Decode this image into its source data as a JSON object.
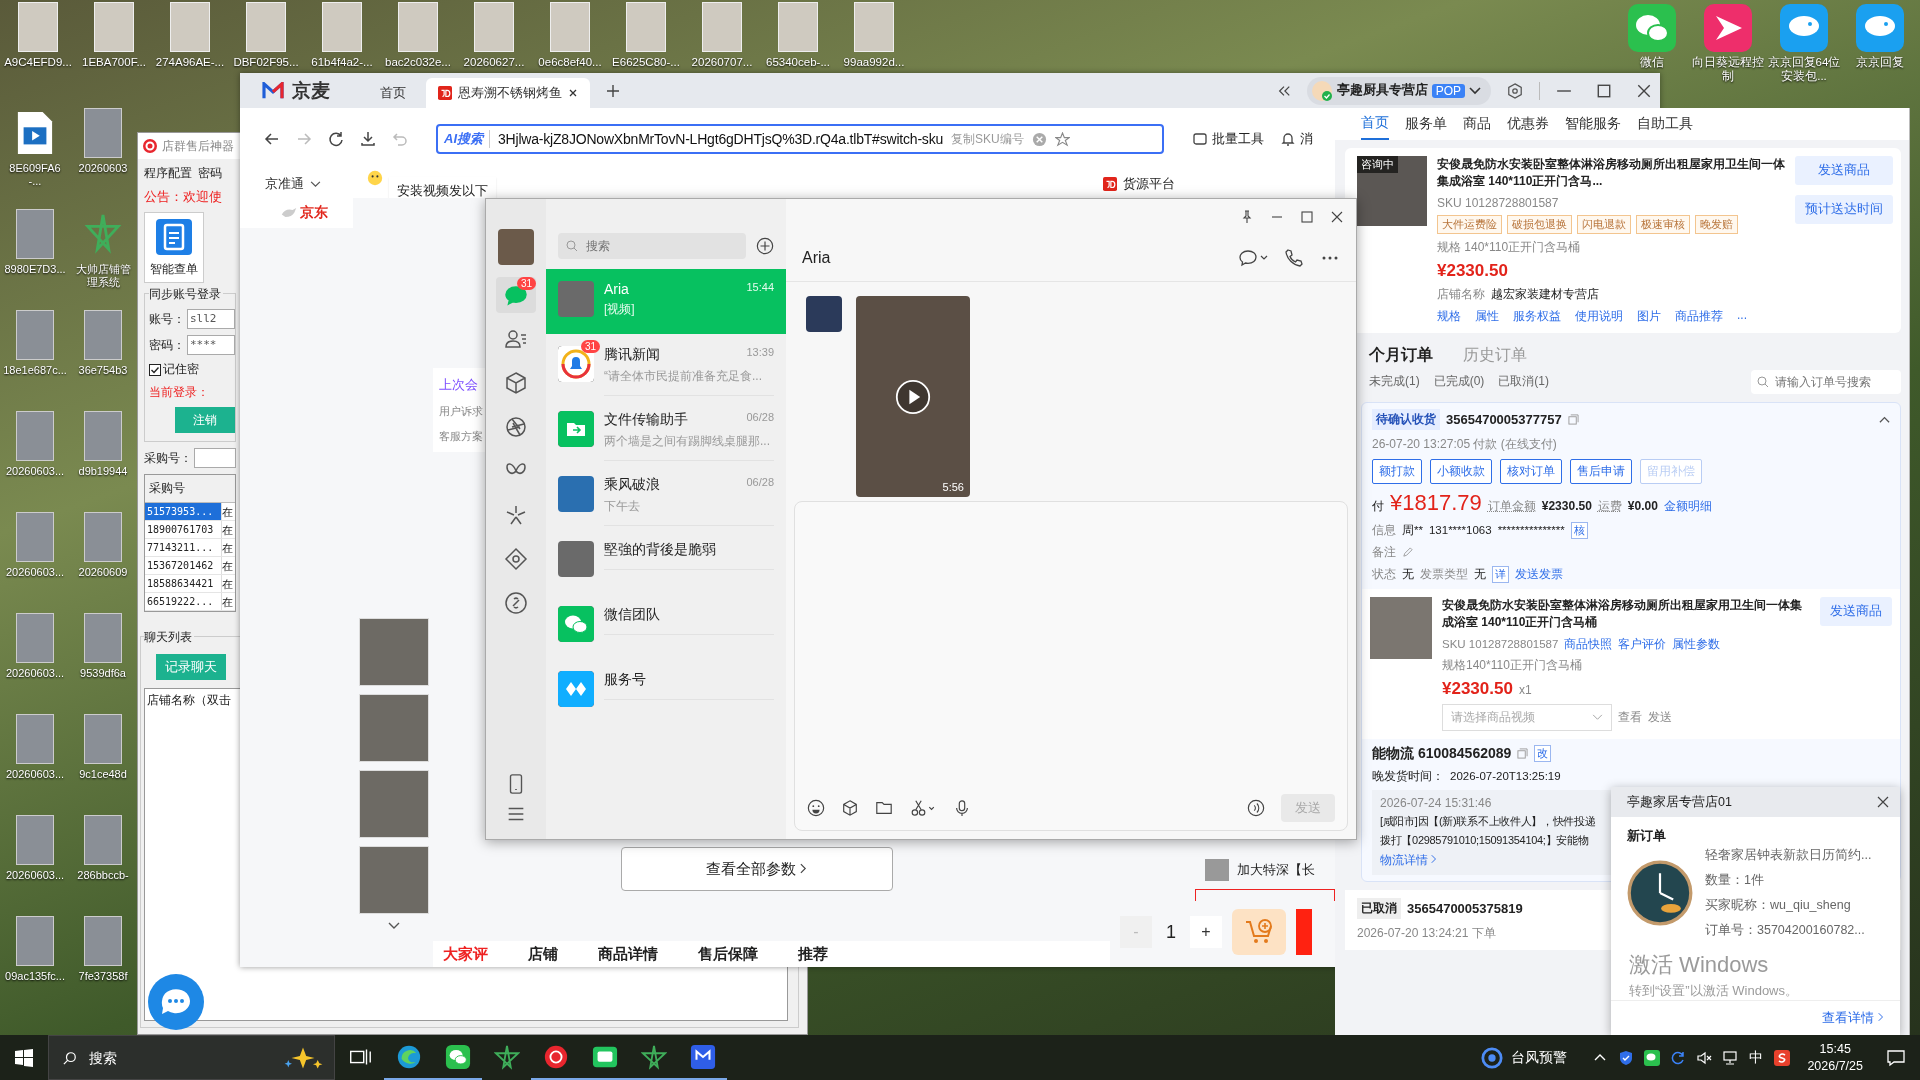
{
  "desktop": {
    "top_icons": [
      {
        "label": "A9C4EFD9..."
      },
      {
        "label": "1EBA700F..."
      },
      {
        "label": "274A96AE-..."
      },
      {
        "label": "DBF02F95..."
      },
      {
        "label": "61b4f4a2-..."
      },
      {
        "label": "bac2c032e..."
      },
      {
        "label": "20260627..."
      },
      {
        "label": "0e6c8ef40..."
      },
      {
        "label": "E6625C80-..."
      },
      {
        "label": "20260707..."
      },
      {
        "label": "65340ceb-..."
      },
      {
        "label": "99aa992d..."
      }
    ],
    "left_icons": [
      {
        "label": "8E609FA6-...",
        "kind": "video"
      },
      {
        "label": "20260603",
        "kind": "thumbnail"
      },
      {
        "label": "8980E7D3...",
        "kind": "thumbnail"
      },
      {
        "label": "大帅店铺管理系统",
        "kind": "star"
      },
      {
        "label": "18e1e687c...",
        "kind": "thumbnail"
      },
      {
        "label": "36e754b3",
        "kind": "thumbnail"
      },
      {
        "label": "20260603...",
        "kind": "thumbnail"
      },
      {
        "label": "d9b19944",
        "kind": "thumbnail"
      },
      {
        "label": "20260603...",
        "kind": "thumbnail"
      },
      {
        "label": "20260609",
        "kind": "thumbnail"
      },
      {
        "label": "20260603...",
        "kind": "thumbnail"
      },
      {
        "label": "9539df6a",
        "kind": "thumbnail"
      },
      {
        "label": "20260603...",
        "kind": "thumbnail"
      },
      {
        "label": "9c1ce48d",
        "kind": "thumbnail"
      },
      {
        "label": "20260603...",
        "kind": "thumbnail"
      },
      {
        "label": "286bbccb-",
        "kind": "thumbnail"
      },
      {
        "label": "09ac135fc...",
        "kind": "thumbnail"
      },
      {
        "label": "7fe37358f",
        "kind": "thumbnail"
      }
    ],
    "app_icons": [
      {
        "label": "微信",
        "kind": "wechat"
      },
      {
        "label": "向日葵远程控制",
        "kind": "sunflower"
      },
      {
        "label": "京京回复64位安装包...",
        "kind": "reply"
      },
      {
        "label": "京京回复",
        "kind": "reply"
      }
    ]
  },
  "helper_window": {
    "title": "店群售后神器",
    "menu": [
      "程序配置",
      "密码"
    ],
    "notice": "公告：欢迎使",
    "tool": "智能查单",
    "login": {
      "legend": "同步账号登录",
      "account_label": "账号：",
      "account": "sll2",
      "password_label": "密码：",
      "password": "****",
      "remember": {
        "label": "记住密",
        "checked": true
      },
      "current": "当前登录：",
      "logout": "注销"
    },
    "purchase_label": "采购号：",
    "table": {
      "column": "采购号",
      "rows": [
        {
          "id": "51573953...",
          "status": "在",
          "selected": true
        },
        {
          "id": "18900761703",
          "status": "在",
          "selected": false
        },
        {
          "id": "77143211...",
          "status": "在",
          "selected": false
        },
        {
          "id": "15367201462",
          "status": "在",
          "selected": false
        },
        {
          "id": "18588634421",
          "status": "在",
          "selected": false
        },
        {
          "id": "66519222...",
          "status": "在",
          "selected": false
        }
      ]
    },
    "chat_list": {
      "legend": "聊天列表",
      "button": "记录聊天",
      "column": "店铺名称（双击"
    }
  },
  "browser": {
    "app_name": "京麦",
    "tabs": [
      {
        "label": "首页",
        "selected": false
      },
      {
        "label": "恩寿溯不锈钢烤鱼",
        "selected": true
      }
    ],
    "store": {
      "name": "亭趣厨具专营店",
      "badge": "POP"
    },
    "address": {
      "ai_label": "AI搜索",
      "url": "3Hjlwa-kjZ8JONowXbnMrTovN-LHgt6gDHTjsQ%3D.rQ4a.tlbT#switch-sku",
      "copy_sku": "复制SKU编号"
    },
    "batch_tools": "批量工具",
    "messages": "消",
    "page": {
      "jingzhuntong": "京准通",
      "logo": "京东",
      "bubble": "安装视频发以下",
      "source": "货源平台",
      "last_session": "上次会",
      "session_lines": [
        "用户诉求",
        "客服方案"
      ],
      "view_params": "查看全部参数",
      "bottom_tabs": [
        {
          "label": "大家评",
          "selected": true
        },
        {
          "label": "店铺",
          "selected": false
        },
        {
          "label": "商品详情",
          "selected": false
        },
        {
          "label": "售后保障",
          "selected": false
        },
        {
          "label": "推荐",
          "selected": false
        }
      ],
      "related_item": "加大特深【长",
      "minus": "-",
      "quantity": "1",
      "plus": "+"
    }
  },
  "service_panel": {
    "tabs": [
      {
        "label": "首页",
        "selected": true
      },
      {
        "label": "服务单",
        "selected": false
      },
      {
        "label": "商品",
        "selected": false
      },
      {
        "label": "优惠券",
        "selected": false
      },
      {
        "label": "智能服务",
        "selected": false
      },
      {
        "label": "自助工具",
        "selected": false
      }
    ],
    "product": {
      "badge": "咨询中",
      "title": "安俊晟免防水安装卧室整体淋浴房移动厕所出租屋家用卫生间一体集成浴室 140*110正开门含马...",
      "sku": "SKU 10128728801587",
      "tags": [
        "大件运费险",
        "破损包退换",
        "闪电退款",
        "极速审核",
        "晚发赔"
      ],
      "spec": "规格 140*110正开门含马桶",
      "price": "¥2330.50",
      "store_label": "店铺名称",
      "store": "越宏家装建材专营店",
      "links": [
        "规格",
        "属性",
        "服务权益",
        "使用说明",
        "图片",
        "商品推荐",
        "..."
      ],
      "buttons": [
        "发送商品",
        "预计送达时间"
      ]
    },
    "order_tabs": [
      {
        "label": "个月订单",
        "selected": true
      },
      {
        "label": "历史订单",
        "selected": false
      }
    ],
    "filters": [
      "未完成(1)",
      "已完成(0)",
      "已取消(1)"
    ],
    "order_search": {
      "placeholder": "请输入订单号搜索"
    },
    "order": {
      "status": "待确认收货",
      "number": "3565470005377757",
      "paid": "26-07-20 13:27:05  付款  (在线支付)",
      "actions": [
        {
          "label": "额打款",
          "disabled": false
        },
        {
          "label": "小额收款",
          "disabled": false
        },
        {
          "label": "核对订单",
          "disabled": false
        },
        {
          "label": "售后申请",
          "disabled": false
        },
        {
          "label": "留用补偿",
          "disabled": true
        }
      ],
      "pay_label": "付",
      "pay": "¥1817.79",
      "total_label": "订单金额",
      "total": "¥2330.50",
      "freight_label": "运费",
      "freight": "¥0.00",
      "detail_link": "金额明细",
      "info_label": "信息",
      "receiver": "周**",
      "phone": "131****1063",
      "address": "***************",
      "verify": "核",
      "remark": "备注",
      "invoice_status_label": "状态",
      "invoice_status": "无",
      "invoice_type_label": "发票类型",
      "invoice_type": "无",
      "invoice_detail": "详",
      "send_invoice": "发送发票",
      "item": {
        "title": "安俊晟免防水安装卧室整体淋浴房移动厕所出租屋家用卫生间一体集成浴室 140*110正开门含马桶",
        "sku": "SKU 10128728801587",
        "links": [
          "商品快照",
          "客户评价",
          "属性参数"
        ],
        "spec": "规格140*110正开门含马桶",
        "price": "¥2330.50",
        "qty": "x1",
        "video_select": {
          "placeholder": "请选择商品视频"
        },
        "view": "查看",
        "send": "发送",
        "send_button": "发送商品"
      },
      "logistics": {
        "title": "能物流 610084562089",
        "edit": "改",
        "deadline_label": "晚发货时间：",
        "deadline": "2026-07-20T13:25:19",
        "time": "2026-07-24 15:31:46",
        "lines": [
          "[咸阳市]因【(新)联系不上收件人】，快件投递",
          "拨打【02985791010;15091354104;】安能物"
        ],
        "detail": "物流详情"
      }
    },
    "cancelled": {
      "status": "已取消",
      "number": "3565470005375819",
      "time": "2026-07-20 13:24:21  下单"
    }
  },
  "wechat": {
    "rail": [
      {
        "kind": "chats",
        "selected": true,
        "badge": "31"
      },
      {
        "kind": "contacts",
        "selected": false
      },
      {
        "kind": "box",
        "selected": false
      },
      {
        "kind": "aperture",
        "selected": false
      },
      {
        "kind": "butterfly",
        "selected": false
      },
      {
        "kind": "sparkle",
        "selected": false
      },
      {
        "kind": "diamond",
        "selected": false
      },
      {
        "kind": "link",
        "selected": false
      }
    ],
    "search": {
      "placeholder": "搜索"
    },
    "chats": [
      {
        "name": "Aria",
        "time": "15:44",
        "preview": "[视频]",
        "kind": "photo",
        "selected": true
      },
      {
        "name": "腾讯新闻",
        "time": "13:39",
        "preview": "“请全体市民提前准备充足食...",
        "kind": "news",
        "badge": "31",
        "selected": false
      },
      {
        "name": "文件传输助手",
        "time": "06/28",
        "preview": "两个墙是之间有踢脚线桌腿那...",
        "kind": "file",
        "selected": false
      },
      {
        "name": "乘风破浪",
        "time": "06/28",
        "preview": "下午去",
        "kind": "wave",
        "selected": false
      },
      {
        "name": "堅強的背後是脆弱",
        "kind": "photo",
        "selected": false
      },
      {
        "name": "微信团队",
        "kind": "wechat",
        "selected": false
      },
      {
        "name": "服务号",
        "kind": "service",
        "selected": false
      }
    ],
    "contact": "Aria",
    "video_duration": "5:56",
    "send": "发送"
  },
  "notification": {
    "store": "亭趣家居专营店01",
    "title": "新订单",
    "lines": [
      "轻奢家居钟表新款日历简约...",
      "数量：1件",
      "买家昵称：wu_qiu_sheng",
      "订单号：35704200160782..."
    ],
    "link": "查看详情"
  },
  "activation": {
    "title": "激活 Windows",
    "hint": "转到“设置”以激活 Windows。"
  },
  "taskbar": {
    "search": {
      "placeholder": "搜索"
    },
    "apps": [
      {
        "kind": "taskview",
        "running": false
      },
      {
        "kind": "edge",
        "running": true
      },
      {
        "kind": "wechat",
        "running": true
      },
      {
        "kind": "star",
        "running": false
      },
      {
        "kind": "record",
        "running": true
      },
      {
        "kind": "chat",
        "running": true
      },
      {
        "kind": "star",
        "running": true
      },
      {
        "kind": "mai",
        "running": true
      }
    ],
    "weather": "台风预警",
    "ime": "中",
    "time": "15:45",
    "date": "2026/7/25"
  }
}
